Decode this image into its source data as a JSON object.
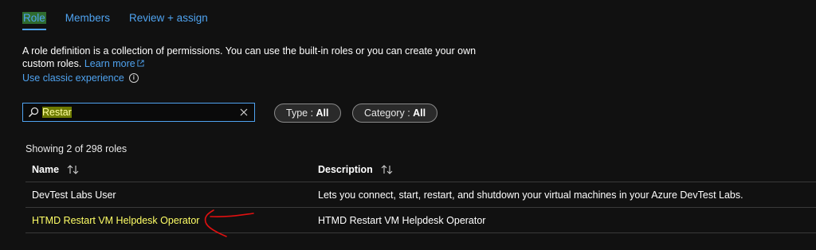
{
  "tabs": [
    {
      "label": "Role",
      "active": true
    },
    {
      "label": "Members",
      "active": false
    },
    {
      "label": "Review + assign",
      "active": false
    }
  ],
  "intro": {
    "text": "A role definition is a collection of permissions. You can use the built-in roles or you can create your own custom roles.",
    "learn_more": "Learn more",
    "classic": "Use classic experience"
  },
  "search": {
    "value": "Restar",
    "icon": "search-icon"
  },
  "filters": {
    "type_label": "Type : ",
    "type_value": "All",
    "category_label": "Category : ",
    "category_value": "All"
  },
  "results": {
    "showing": "Showing 2 of 298 roles"
  },
  "table": {
    "columns": [
      "Name",
      "Description"
    ],
    "rows": [
      {
        "name": "DevTest Labs User",
        "description": "Lets you connect, start, restart, and shutdown your virtual machines in your Azure DevTest Labs."
      },
      {
        "name": "HTMD Restart VM Helpdesk Operator",
        "description": "HTMD Restart VM Helpdesk Operator"
      }
    ]
  },
  "colors": {
    "accent": "#4fa3f0",
    "background": "#111111",
    "highlight": "#ffff66",
    "annotation": "#e01010"
  }
}
